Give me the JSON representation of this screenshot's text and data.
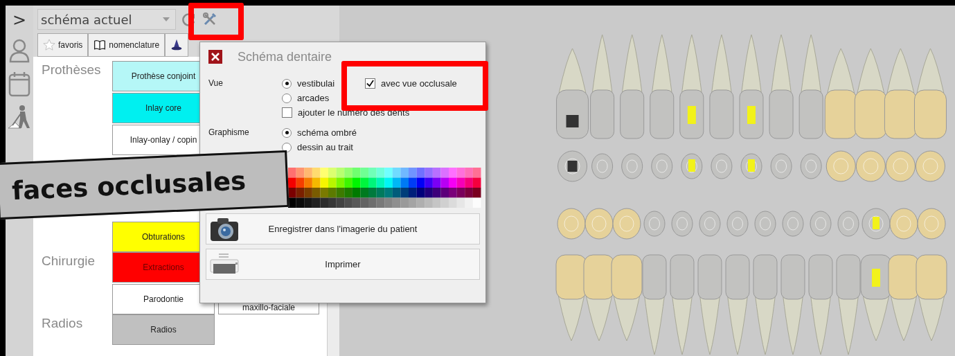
{
  "sidebar": {
    "toggle": ">",
    "items": [
      {
        "kind": "patient"
      },
      {
        "kind": "calendar"
      },
      {
        "kind": "worker"
      }
    ]
  },
  "toolbar": {
    "scheme_select": {
      "value": "schéma actuel"
    }
  },
  "tabs": [
    {
      "kind": "favorites",
      "label": "favoris"
    },
    {
      "kind": "catalog",
      "label": "nomenclature"
    },
    {
      "kind": "wizard"
    }
  ],
  "categories": [
    {
      "label": "Prothèses",
      "rows": [
        [
          {
            "label": "Prothèse conjoint",
            "color": "#b5f7f7"
          }
        ],
        [
          {
            "label": "Inlay core",
            "color": "#00f0f0"
          }
        ],
        [
          {
            "label": "Inlay-onlay / copin",
            "color": "#ffffff"
          }
        ]
      ]
    },
    {
      "rows": [
        [
          {
            "label": "Obturations",
            "color": "#ffff00"
          }
        ]
      ]
    },
    {
      "label": "Chirurgie",
      "rows": [
        [
          {
            "label": "Extractions",
            "color": "#ff0000"
          }
        ],
        [
          {
            "label": "Parodontie",
            "color": "#ffffff"
          },
          {
            "label": "maxillo-faciale",
            "color": "#ffffff"
          }
        ]
      ]
    },
    {
      "label": "Radios",
      "rows": [
        [
          {
            "label": "Radios",
            "color": "#c0c0c0"
          }
        ]
      ]
    }
  ],
  "dialog": {
    "title": "Schéma dentaire",
    "sections": [
      {
        "label": "Vue",
        "options": [
          {
            "kind": "radio",
            "label": "vestibulai",
            "selected": true
          },
          {
            "kind": "radio",
            "label": "arcades",
            "selected": false
          },
          {
            "kind": "checkbox",
            "label": "ajouter le numéro des dents",
            "checked": false
          }
        ],
        "side_option": {
          "kind": "checkbox",
          "label": "avec vue occlusale",
          "checked": true
        }
      },
      {
        "label": "Graphisme",
        "options": [
          {
            "kind": "radio",
            "label": "schéma ombré",
            "selected": true
          },
          {
            "kind": "radio",
            "label": "dessin au trait",
            "selected": false
          }
        ]
      }
    ],
    "buttons": [
      {
        "kind": "camera",
        "label": "Enregistrer dans l'imagerie du patient"
      },
      {
        "kind": "printer",
        "label": "Imprimer"
      }
    ]
  },
  "callout": {
    "text": "faces occlusales"
  },
  "dental_chart": {
    "upper": [
      {
        "kind": "core"
      },
      {
        "kind": "natural"
      },
      {
        "kind": "natural"
      },
      {
        "kind": "natural"
      },
      {
        "kind": "filling"
      },
      {
        "kind": "natural"
      },
      {
        "kind": "filling"
      },
      {
        "kind": "natural"
      },
      {
        "kind": "natural"
      },
      {
        "kind": "crown"
      },
      {
        "kind": "crown"
      },
      {
        "kind": "crown"
      },
      {
        "kind": "crown"
      }
    ],
    "lower": [
      {
        "kind": "crown"
      },
      {
        "kind": "crown"
      },
      {
        "kind": "crown"
      },
      {
        "kind": "natural"
      },
      {
        "kind": "natural"
      },
      {
        "kind": "natural"
      },
      {
        "kind": "natural"
      },
      {
        "kind": "natural"
      },
      {
        "kind": "natural"
      },
      {
        "kind": "natural"
      },
      {
        "kind": "natural"
      },
      {
        "kind": "filling"
      },
      {
        "kind": "crown"
      },
      {
        "kind": "crown"
      }
    ]
  }
}
